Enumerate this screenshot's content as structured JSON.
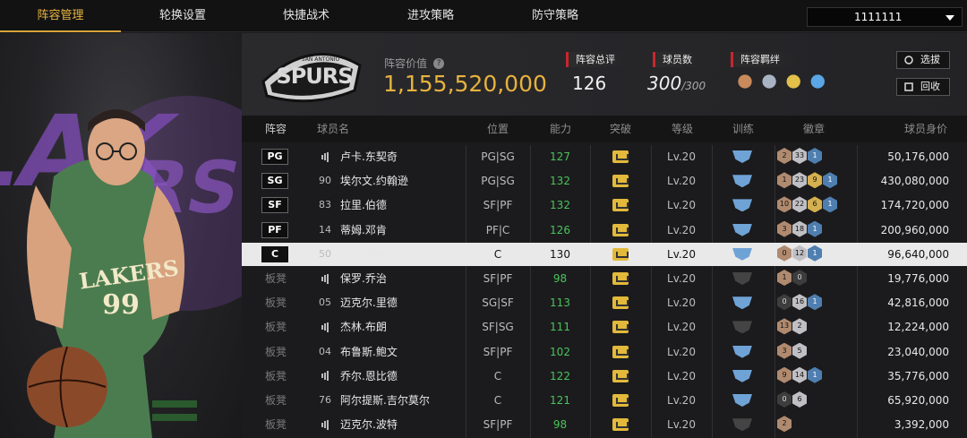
{
  "nav": {
    "tabs": [
      "阵容管理",
      "轮换设置",
      "快捷战术",
      "进攻策略",
      "防守策略"
    ],
    "active": 0,
    "account": "1111111"
  },
  "header": {
    "team_value_label": "阵容价值",
    "team_value": "1,155,520,000",
    "rating_label": "阵容总评",
    "rating": "126",
    "players_label": "球员数",
    "players": "300",
    "players_max": "/300",
    "bond_label": "阵容羁绊",
    "select_label": "选拔",
    "recycle_label": "回收"
  },
  "logo": {
    "text": "SPURS",
    "small": "SAN ANTONIO"
  },
  "portrait": {
    "jersey_team": "LAKERS",
    "jersey_number": "99"
  },
  "table": {
    "headers": [
      "阵容",
      "球员名",
      "位置",
      "能力",
      "突破",
      "等级",
      "训练",
      "徽章",
      "球员身价"
    ],
    "rows": [
      {
        "slot": "PG",
        "num": "",
        "name": "卢卡.东契奇",
        "pos": "PG|SG",
        "ability": "127",
        "level": "Lv.20",
        "train": "#6fa3d6",
        "badges": [
          [
            "2",
            "bronze"
          ],
          [
            "33",
            "silver"
          ],
          [
            "1",
            "blue"
          ]
        ],
        "value": "50,176,000"
      },
      {
        "slot": "SG",
        "num": "90",
        "name": "埃尔文.约翰逊",
        "pos": "PG|SG",
        "ability": "132",
        "level": "Lv.20",
        "train": "#6fa3d6",
        "badges": [
          [
            "1",
            "bronze"
          ],
          [
            "23",
            "silver"
          ],
          [
            "9",
            "gold"
          ],
          [
            "1",
            "blue"
          ]
        ],
        "value": "430,080,000"
      },
      {
        "slot": "SF",
        "num": "83",
        "name": "拉里.伯德",
        "pos": "SF|PF",
        "ability": "132",
        "level": "Lv.20",
        "train": "#6fa3d6",
        "badges": [
          [
            "10",
            "bronze"
          ],
          [
            "22",
            "silver"
          ],
          [
            "6",
            "gold"
          ],
          [
            "1",
            "blue"
          ]
        ],
        "value": "174,720,000"
      },
      {
        "slot": "PF",
        "num": "14",
        "name": "蒂姆.邓肯",
        "pos": "PF|C",
        "ability": "126",
        "level": "Lv.20",
        "train": "#6fa3d6",
        "badges": [
          [
            "3",
            "bronze"
          ],
          [
            "18",
            "silver"
          ],
          [
            "1",
            "blue"
          ]
        ],
        "value": "200,960,000"
      },
      {
        "slot": "C",
        "num": "50",
        "name": "乔治.麦肯",
        "pos": "C",
        "ability": "130",
        "level": "Lv.20",
        "train": "#6fa3d6",
        "badges": [
          [
            "0",
            "bronze"
          ],
          [
            "12",
            "silver"
          ],
          [
            "1",
            "blue"
          ]
        ],
        "value": "96,640,000",
        "selected": true
      },
      {
        "slot": "板凳",
        "num": "",
        "name": "保罗.乔治",
        "pos": "SF|PF",
        "ability": "98",
        "level": "Lv.20",
        "train": "#444",
        "badges": [
          [
            "1",
            "bronze"
          ],
          [
            "0",
            "dark"
          ]
        ],
        "value": "19,776,000"
      },
      {
        "slot": "板凳",
        "num": "05",
        "name": "迈克尔.里德",
        "pos": "SG|SF",
        "ability": "113",
        "level": "Lv.20",
        "train": "#6fa3d6",
        "badges": [
          [
            "0",
            "dark"
          ],
          [
            "16",
            "silver"
          ],
          [
            "1",
            "blue"
          ]
        ],
        "value": "42,816,000"
      },
      {
        "slot": "板凳",
        "num": "",
        "name": "杰林.布朗",
        "pos": "SF|SG",
        "ability": "111",
        "level": "Lv.20",
        "train": "#444",
        "badges": [
          [
            "13",
            "bronze"
          ],
          [
            "2",
            "silver"
          ]
        ],
        "value": "12,224,000"
      },
      {
        "slot": "板凳",
        "num": "04",
        "name": "布鲁斯.鲍文",
        "pos": "SF|PF",
        "ability": "102",
        "level": "Lv.20",
        "train": "#6fa3d6",
        "badges": [
          [
            "3",
            "bronze"
          ],
          [
            "5",
            "silver"
          ]
        ],
        "value": "23,040,000"
      },
      {
        "slot": "板凳",
        "num": "",
        "name": "乔尔.恩比德",
        "pos": "C",
        "ability": "122",
        "level": "Lv.20",
        "train": "#6fa3d6",
        "badges": [
          [
            "9",
            "bronze"
          ],
          [
            "14",
            "silver"
          ],
          [
            "1",
            "blue"
          ]
        ],
        "value": "35,776,000"
      },
      {
        "slot": "板凳",
        "num": "76",
        "name": "阿尔提斯.吉尔莫尔",
        "pos": "C",
        "ability": "121",
        "level": "Lv.20",
        "train": "#6fa3d6",
        "badges": [
          [
            "0",
            "dark"
          ],
          [
            "6",
            "silver"
          ]
        ],
        "value": "65,920,000"
      },
      {
        "slot": "板凳",
        "num": "",
        "name": "迈克尔.波特",
        "pos": "SF|PF",
        "ability": "98",
        "level": "Lv.20",
        "train": "#444",
        "badges": [
          [
            "2",
            "bronze"
          ]
        ],
        "value": "3,392,000"
      }
    ]
  }
}
